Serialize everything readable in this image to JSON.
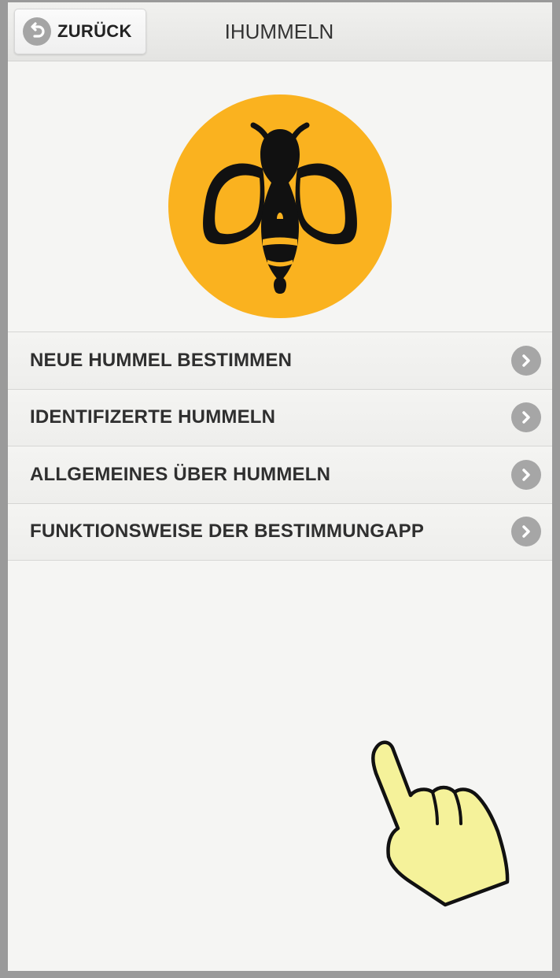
{
  "header": {
    "back_label": "ZURÜCK",
    "title": "IHUMMELN"
  },
  "logo": {
    "icon": "bumblebee-logo",
    "background_color": "#fab21f",
    "bee_color": "#111111"
  },
  "menu": {
    "items": [
      {
        "label": "NEUE HUMMEL BESTIMMEN",
        "icon": "chevron-right-icon"
      },
      {
        "label": "IDENTIFIZERTE HUMMELN",
        "icon": "chevron-right-icon"
      },
      {
        "label": "ALLGEMEINES ÜBER HUMMELN",
        "icon": "chevron-right-icon"
      },
      {
        "label": "FUNKTIONSWEISE DER BESTIMMUNGAPP",
        "icon": "chevron-right-icon"
      }
    ]
  },
  "overlay": {
    "icon": "tap-hand-icon",
    "color": "#f5f29a"
  }
}
